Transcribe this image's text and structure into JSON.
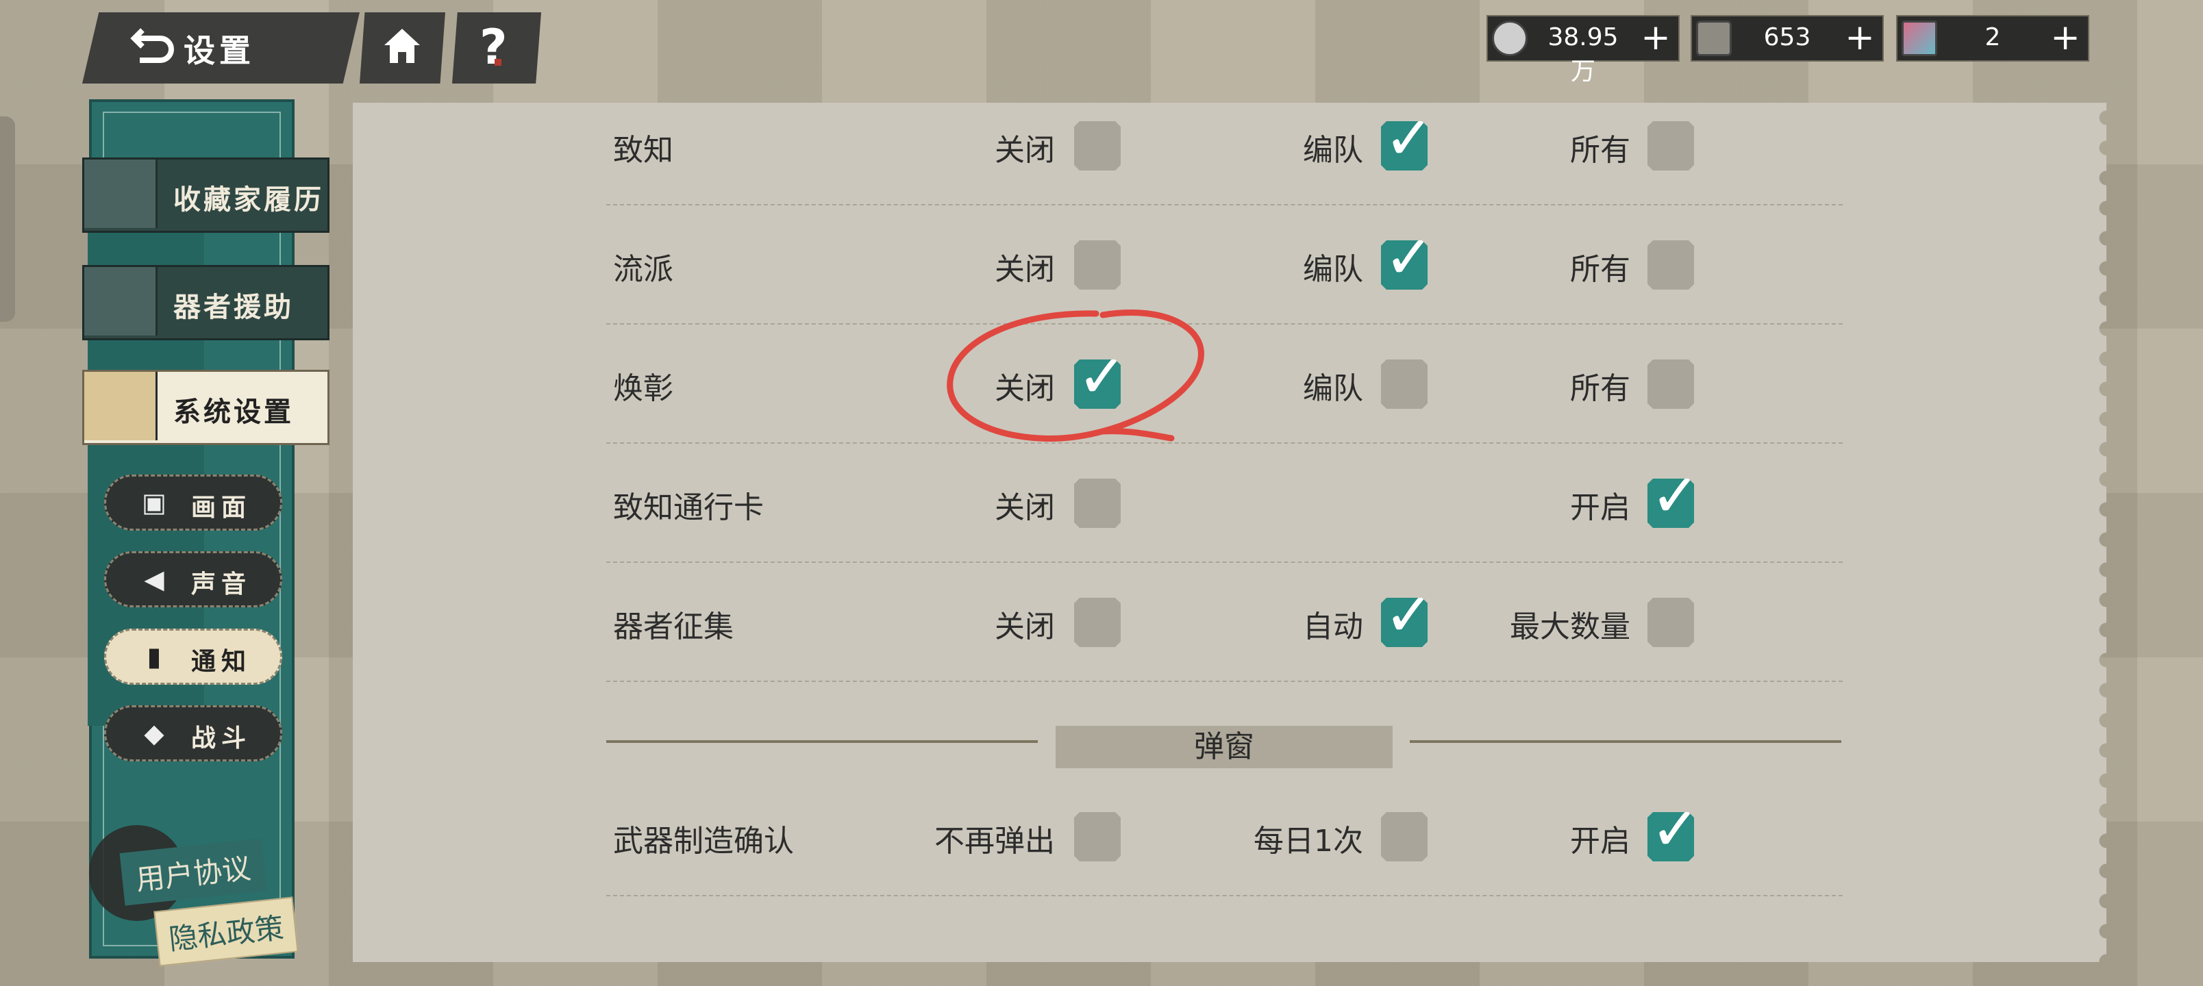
{
  "header": {
    "back_label": "设置",
    "icons": [
      "back-arrow-icon",
      "home-icon",
      "help-icon"
    ],
    "help_glyph": "?"
  },
  "resources": [
    {
      "icon": "coin-icon",
      "value": "38.95万",
      "plus": "+"
    },
    {
      "icon": "material-icon",
      "value": "653",
      "plus": "+"
    },
    {
      "icon": "crystal-icon",
      "value": "2",
      "plus": "+"
    }
  ],
  "sidebar": {
    "items": [
      {
        "label": "收藏家履历",
        "icon": "collector-icon"
      },
      {
        "label": "器者援助",
        "icon": "handshake-icon"
      },
      {
        "label": "系统设置",
        "icon": "gear-icon",
        "selected": true
      }
    ],
    "sub_items": [
      {
        "label": "画面",
        "icon": "image-icon"
      },
      {
        "label": "声音",
        "icon": "speaker-icon"
      },
      {
        "label": "通知",
        "icon": "phone-bell-icon",
        "selected": true
      },
      {
        "label": "战斗",
        "icon": "battle-icon"
      }
    ],
    "user_agreement": "用户协议",
    "privacy_policy": "隐私政策"
  },
  "settings": {
    "rows": [
      {
        "label": "致知",
        "options": [
          {
            "label": "关闭",
            "checked": false
          },
          {
            "label": "编队",
            "checked": true
          },
          {
            "label": "所有",
            "checked": false
          }
        ]
      },
      {
        "label": "流派",
        "options": [
          {
            "label": "关闭",
            "checked": false
          },
          {
            "label": "编队",
            "checked": true
          },
          {
            "label": "所有",
            "checked": false
          }
        ]
      },
      {
        "label": "焕彰",
        "options": [
          {
            "label": "关闭",
            "checked": true
          },
          {
            "label": "编队",
            "checked": false
          },
          {
            "label": "所有",
            "checked": false
          }
        ]
      },
      {
        "label": "致知通行卡",
        "options": [
          {
            "label": "关闭",
            "checked": false
          },
          {
            "label": "开启",
            "checked": true
          }
        ]
      },
      {
        "label": "器者征集",
        "options": [
          {
            "label": "关闭",
            "checked": false
          },
          {
            "label": "自动",
            "checked": true
          },
          {
            "label": "最大数量",
            "checked": false
          }
        ]
      }
    ],
    "section_title": "弹窗",
    "popup_rows": [
      {
        "label": "武器制造确认",
        "options": [
          {
            "label": "不再弹出",
            "checked": false
          },
          {
            "label": "每日1次",
            "checked": false
          },
          {
            "label": "开启",
            "checked": true
          }
        ]
      }
    ],
    "check_glyph": "✓"
  },
  "colors": {
    "accent": "#2a8c82",
    "panel": "#cbc7bc",
    "sidebar": "#2a6f6a",
    "annotation": "#e0473f"
  }
}
